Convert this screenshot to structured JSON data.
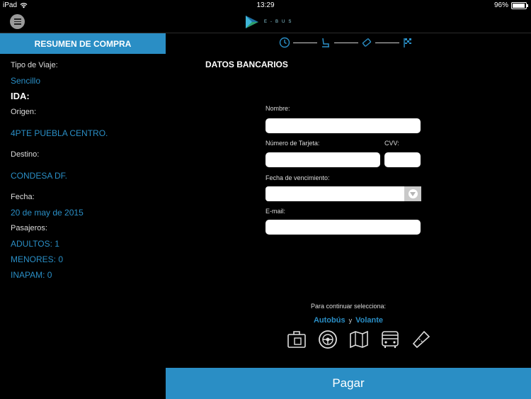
{
  "status_bar": {
    "device": "iPad",
    "time": "13:29",
    "battery": "96%",
    "battery_level": 0.96
  },
  "header": {
    "logo_text": "E-BUS"
  },
  "sidebar": {
    "title": "RESUMEN DE COMPRA",
    "trip_type_label": "Tipo de Viaje:",
    "trip_type_value": "Sencillo",
    "ida_label": "IDA:",
    "origin_label": "Origen:",
    "origin_value": "4PTE PUEBLA CENTRO.",
    "destination_label": "Destino:",
    "destination_value": "CONDESA DF.",
    "date_label": "Fecha:",
    "date_value": "20 de may de 2015",
    "passengers_label": "Pasajeros:",
    "adults": "ADULTOS: 1",
    "minors": "MENORES: 0",
    "inapam": "INAPAM: 0"
  },
  "steps": [
    "clock-icon",
    "seat-icon",
    "ticket-icon",
    "checkered-flag-icon"
  ],
  "form": {
    "title": "DATOS BANCARIOS",
    "name_label": "Nombre:",
    "name_value": "",
    "card_label": "Número de Tarjeta:",
    "card_value": "",
    "cvv_label": "CVV:",
    "cvv_value": "",
    "expiry_label": "Fecha de vencimiento:",
    "expiry_value": "",
    "email_label": "E-mail:",
    "email_value": ""
  },
  "continue": {
    "text": "Para continuar selecciona:",
    "option1": "Autobús",
    "connector": "y",
    "option2": "Volante"
  },
  "bottom_icons": [
    "luggage-icon",
    "steering-wheel-icon",
    "map-icon",
    "bus-icon",
    "ticket-icon"
  ],
  "pay_button": "Pagar",
  "colors": {
    "accent": "#2a8ec5",
    "background": "#000000"
  }
}
